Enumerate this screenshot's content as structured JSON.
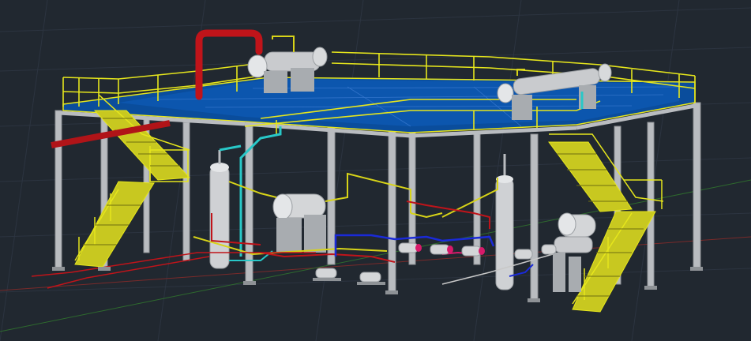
{
  "viewport": {
    "background": "#212830",
    "grid_color": "#2c3440",
    "x_axis_color": "#7a2a2a",
    "y_axis_color": "#2e6a2e"
  },
  "model": {
    "colors": {
      "steel": "#b9bcc0",
      "steel_dark": "#8e9296",
      "handrail": "#e6e61c",
      "deck": "#0a4d9c",
      "deck_grid": "#3a7ad0",
      "vessel": "#d4d6d8",
      "pipe_red": "#c0141a",
      "pipe_yellow": "#d8d418",
      "pipe_cyan": "#28c8c8",
      "pipe_blue": "#1a2ad8",
      "pipe_magenta": "#d81a6a"
    },
    "components": [
      "platform-deck",
      "handrail",
      "stair-left",
      "stair-right",
      "vertical-vessel-left",
      "vertical-vessel-right",
      "heat-exchanger-top-left",
      "heat-exchanger-top-right",
      "horizontal-drum-center",
      "horizontal-drum-right",
      "pump-row",
      "red-gooseneck-pipe"
    ]
  }
}
